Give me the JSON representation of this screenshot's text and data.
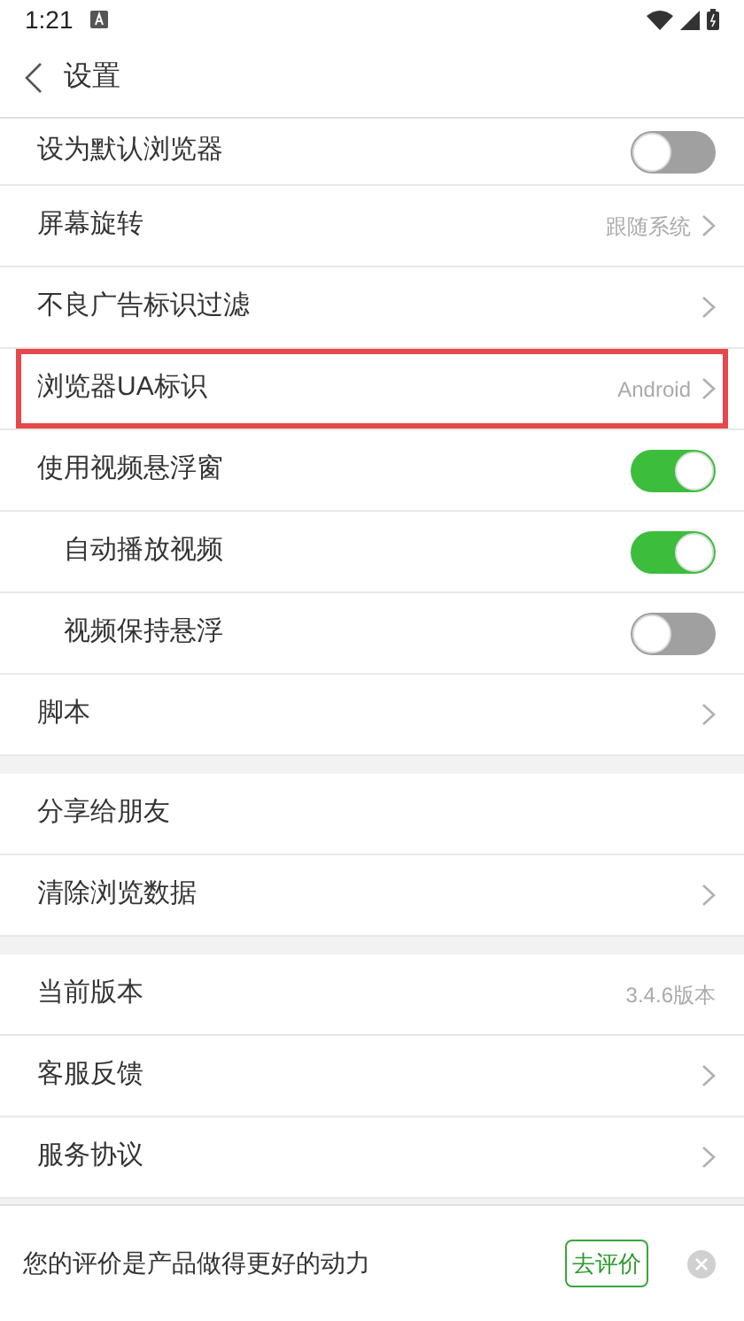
{
  "status_bar": {
    "time": "1:21"
  },
  "header": {
    "title": "设置"
  },
  "groups": [
    {
      "items": [
        {
          "kind": "toggle",
          "label": "设为默认浏览器",
          "on": false,
          "highlighted": false
        },
        {
          "kind": "link",
          "label": "屏幕旋转",
          "value": "跟随系统",
          "highlighted": false
        },
        {
          "kind": "link",
          "label": "不良广告标识过滤",
          "highlighted": false
        },
        {
          "kind": "link",
          "label": "浏览器UA标识",
          "value": "Android",
          "highlighted": true
        },
        {
          "kind": "toggle",
          "label": "使用视频悬浮窗",
          "on": true,
          "highlighted": false,
          "children": [
            {
              "kind": "toggle",
              "label": "自动播放视频",
              "on": true,
              "highlighted": false
            },
            {
              "kind": "toggle",
              "label": "视频保持悬浮",
              "on": false,
              "highlighted": false
            }
          ]
        },
        {
          "kind": "link",
          "label": "脚本",
          "highlighted": false
        }
      ]
    },
    {
      "items": [
        {
          "kind": "plain",
          "label": "分享给朋友",
          "highlighted": false
        },
        {
          "kind": "link",
          "label": "清除浏览数据",
          "highlighted": false
        }
      ]
    },
    {
      "items": [
        {
          "kind": "plain",
          "label": "当前版本",
          "value": "3.4.6版本",
          "highlighted": false
        },
        {
          "kind": "link",
          "label": "客服反馈",
          "highlighted": false
        },
        {
          "kind": "link",
          "label": "服务协议",
          "highlighted": false
        }
      ]
    }
  ],
  "banner": {
    "text": "您的评价是产品做得更好的动力",
    "button": "去评价"
  }
}
